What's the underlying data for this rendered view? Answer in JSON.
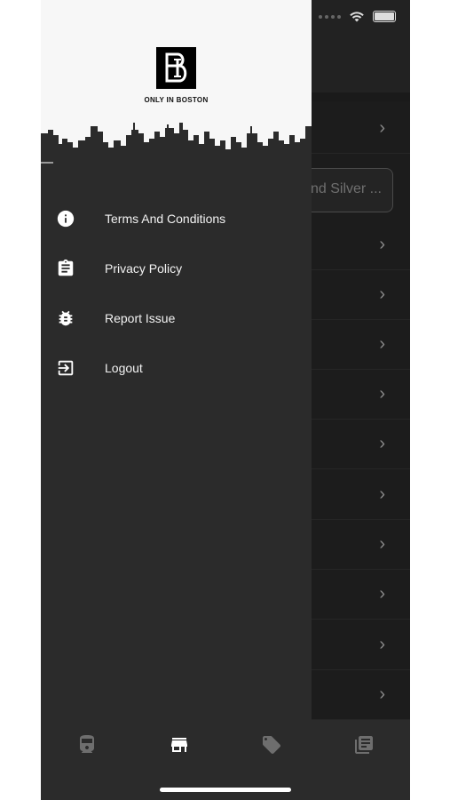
{
  "drawer": {
    "brand_text": "ONLY IN BOSTON",
    "menu": [
      {
        "label": "Terms And Conditions",
        "icon": "info-icon"
      },
      {
        "label": "Privacy Policy",
        "icon": "clipboard-icon"
      },
      {
        "label": "Report Issue",
        "icon": "bug-icon"
      },
      {
        "label": "Logout",
        "icon": "logout-icon"
      }
    ]
  },
  "background": {
    "search_text": "nd Silver ...",
    "chevron": "›"
  },
  "tabbar": {
    "tabs": [
      {
        "icon": "train-icon",
        "active": false
      },
      {
        "icon": "store-icon",
        "active": true
      },
      {
        "icon": "tag-icon",
        "active": false
      },
      {
        "icon": "news-icon",
        "active": false
      }
    ]
  },
  "colors": {
    "drawer_bg": "#2b2b2b",
    "header_bg": "#f7f7f7",
    "text": "#f2f2f2",
    "inactive_icon": "#6e6e6e",
    "active_icon": "#ffffff"
  }
}
